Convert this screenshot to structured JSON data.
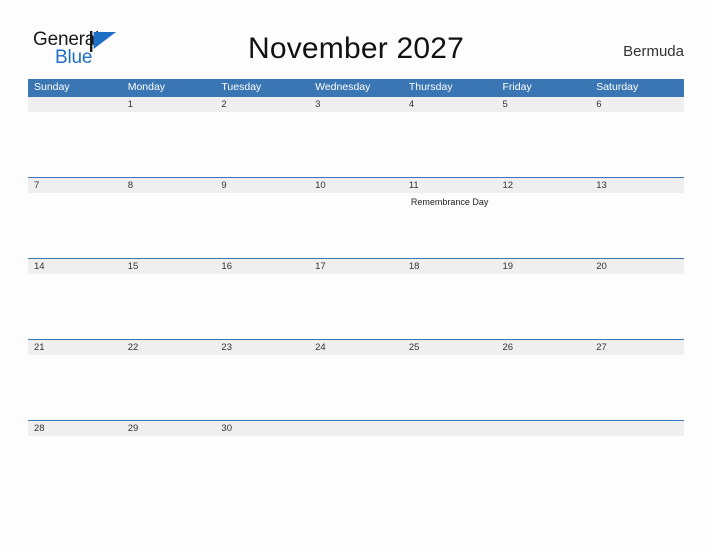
{
  "brand": {
    "name_primary": "General",
    "name_secondary": "Blue",
    "flag_icon": "blue-flag-icon",
    "primary_color": "#1a1a1a",
    "secondary_color": "#1f6fc4"
  },
  "header": {
    "title": "November 2027",
    "location": "Bermuda"
  },
  "colors": {
    "header_blue": "#3a76b4",
    "band_gray": "#efefef",
    "page_background": "#fdfdfd",
    "text_dark": "#333333"
  },
  "calendar": {
    "month": "November",
    "year": "2027",
    "weekday_headers": [
      "Sunday",
      "Monday",
      "Tuesday",
      "Wednesday",
      "Thursday",
      "Friday",
      "Saturday"
    ],
    "weeks": [
      {
        "days": [
          {
            "num": "",
            "event": ""
          },
          {
            "num": "1",
            "event": ""
          },
          {
            "num": "2",
            "event": ""
          },
          {
            "num": "3",
            "event": ""
          },
          {
            "num": "4",
            "event": ""
          },
          {
            "num": "5",
            "event": ""
          },
          {
            "num": "6",
            "event": ""
          }
        ]
      },
      {
        "days": [
          {
            "num": "7",
            "event": ""
          },
          {
            "num": "8",
            "event": ""
          },
          {
            "num": "9",
            "event": ""
          },
          {
            "num": "10",
            "event": ""
          },
          {
            "num": "11",
            "event": "Remembrance Day"
          },
          {
            "num": "12",
            "event": ""
          },
          {
            "num": "13",
            "event": ""
          }
        ]
      },
      {
        "days": [
          {
            "num": "14",
            "event": ""
          },
          {
            "num": "15",
            "event": ""
          },
          {
            "num": "16",
            "event": ""
          },
          {
            "num": "17",
            "event": ""
          },
          {
            "num": "18",
            "event": ""
          },
          {
            "num": "19",
            "event": ""
          },
          {
            "num": "20",
            "event": ""
          }
        ]
      },
      {
        "days": [
          {
            "num": "21",
            "event": ""
          },
          {
            "num": "22",
            "event": ""
          },
          {
            "num": "23",
            "event": ""
          },
          {
            "num": "24",
            "event": ""
          },
          {
            "num": "25",
            "event": ""
          },
          {
            "num": "26",
            "event": ""
          },
          {
            "num": "27",
            "event": ""
          }
        ]
      },
      {
        "days": [
          {
            "num": "28",
            "event": ""
          },
          {
            "num": "29",
            "event": ""
          },
          {
            "num": "30",
            "event": ""
          },
          {
            "num": "",
            "event": ""
          },
          {
            "num": "",
            "event": ""
          },
          {
            "num": "",
            "event": ""
          },
          {
            "num": "",
            "event": ""
          }
        ]
      }
    ]
  }
}
